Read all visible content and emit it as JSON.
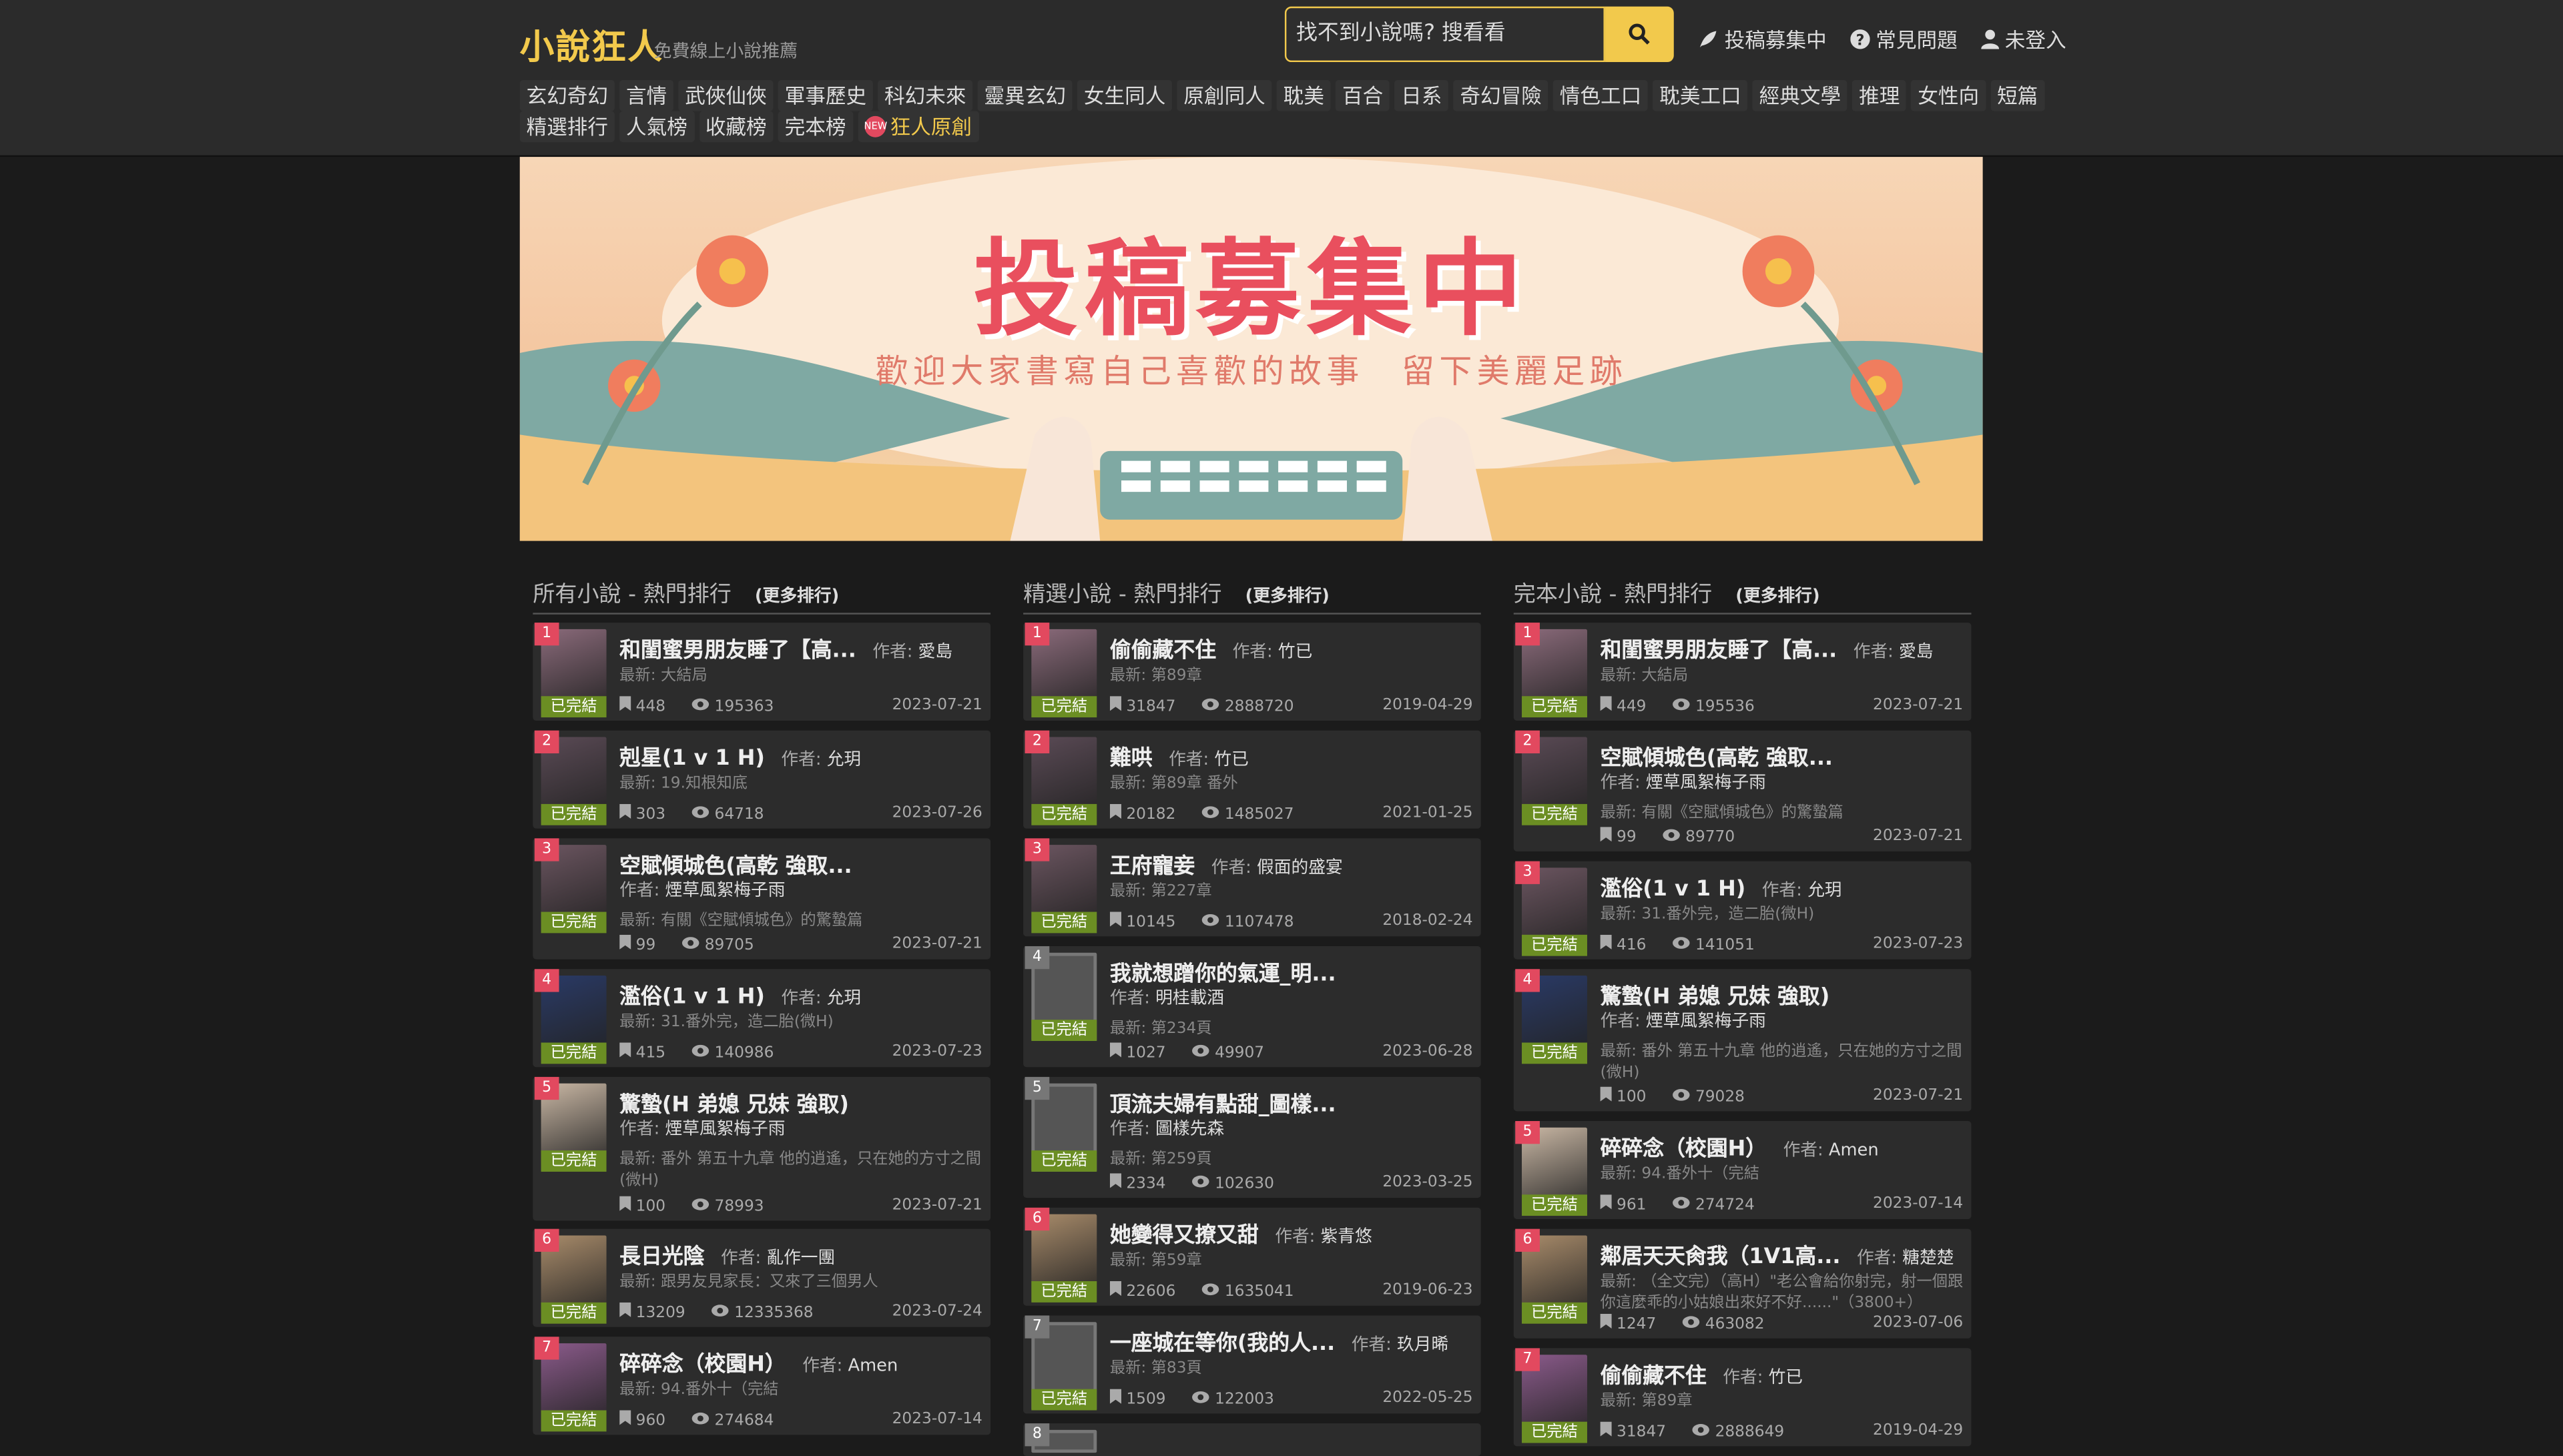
{
  "header": {
    "logo": "小說狂人",
    "tagline": "免費線上小說推薦",
    "search_value": "找不到小說嗎? 搜看看",
    "links": {
      "submit": "投稿募集中",
      "faq": "常見問題",
      "login": "未登入"
    },
    "nav_row1": [
      "玄幻奇幻",
      "言情",
      "武俠仙俠",
      "軍事歷史",
      "科幻未來",
      "靈異玄幻",
      "女生同人",
      "原創同人",
      "耽美",
      "百合",
      "日系",
      "奇幻冒險",
      "情色工口",
      "耽美工口",
      "經典文學",
      "推理",
      "女性向",
      "短篇"
    ],
    "nav_row2": [
      "精選排行",
      "人氣榜",
      "收藏榜",
      "完本榜"
    ],
    "nav_special": "狂人原創",
    "new_badge": "NEW"
  },
  "banner": {
    "title": "投稿募集中",
    "subtitle": "歡迎大家書寫自己喜歡的故事　留下美麗足跡"
  },
  "labels": {
    "author": "作者:",
    "latest": "最新:",
    "done": "已完結",
    "more": "(更多排行)"
  },
  "col1": {
    "title": "所有小說 - 熱門排行",
    "items": [
      {
        "rank": "1",
        "title": "和閨蜜男朋友睡了【高...",
        "author": "愛島",
        "latest": "大結局",
        "fav": "448",
        "views": "195363",
        "date": "2023-07-21"
      },
      {
        "rank": "2",
        "title": "剋星(1 v 1 H)",
        "author": "允玥",
        "latest": "19.知根知底",
        "fav": "303",
        "views": "64718",
        "date": "2023-07-26"
      },
      {
        "rank": "3",
        "title": "空賦傾城色(高乾 強取...",
        "author": "煙草風絮梅子雨",
        "latest": "有關《空賦傾城色》的驚蟄篇",
        "fav": "99",
        "views": "89705",
        "date": "2023-07-21"
      },
      {
        "rank": "4",
        "title": "濫俗(1 v 1 H)",
        "author": "允玥",
        "latest": "31.番外完，造二胎(微H)",
        "fav": "415",
        "views": "140986",
        "date": "2023-07-23"
      },
      {
        "rank": "5",
        "title": "驚蟄(H 弟媳 兄妹 強取)",
        "author": "煙草風絮梅子雨",
        "latest": "番外 第五十九章 他的逍遙，只在她的方寸之間",
        "latest2": "(微H)",
        "fav": "100",
        "views": "78993",
        "date": "2023-07-21"
      },
      {
        "rank": "6",
        "title": "長日光陰",
        "author": "亂作一團",
        "latest": "跟男友見家長：又來了三個男人",
        "fav": "13209",
        "views": "12335368",
        "date": "2023-07-24"
      },
      {
        "rank": "7",
        "title": "碎碎念（校園H）",
        "author": "Amen",
        "latest": "94.番外十（完結",
        "fav": "960",
        "views": "274684",
        "date": "2023-07-14"
      }
    ]
  },
  "col2": {
    "title": "精選小說 - 熱門排行",
    "items": [
      {
        "rank": "1",
        "title": "偷偷藏不住",
        "author": "竹已",
        "latest": "第89章",
        "fav": "31847",
        "views": "2888720",
        "date": "2019-04-29"
      },
      {
        "rank": "2",
        "title": "難哄",
        "author": "竹已",
        "latest": "第89章 番外",
        "fav": "20182",
        "views": "1485027",
        "date": "2021-01-25"
      },
      {
        "rank": "3",
        "title": "王府寵妾",
        "author": "假面的盛宴",
        "latest": "第227章",
        "fav": "10145",
        "views": "1107478",
        "date": "2018-02-24"
      },
      {
        "rank": "4",
        "title": "我就想蹭你的氣運_明...",
        "author": "明桂載酒",
        "latest": "第234頁",
        "fav": "1027",
        "views": "49907",
        "date": "2023-06-28"
      },
      {
        "rank": "5",
        "title": "頂流夫婦有點甜_圖樣...",
        "author": "圖樣先森",
        "latest": "第259頁",
        "fav": "2334",
        "views": "102630",
        "date": "2023-03-25"
      },
      {
        "rank": "6",
        "title": "她變得又撩又甜",
        "author": "紫青悠",
        "latest": "第59章",
        "fav": "22606",
        "views": "1635041",
        "date": "2019-06-23"
      },
      {
        "rank": "7",
        "title": "一座城在等你(我的人...",
        "author": "玖月晞",
        "latest": "第83頁",
        "fav": "1509",
        "views": "122003",
        "date": "2022-05-25"
      },
      {
        "rank": "8"
      }
    ]
  },
  "col3": {
    "title": "完本小說 - 熱門排行",
    "items": [
      {
        "rank": "1",
        "title": "和閨蜜男朋友睡了【高...",
        "author": "愛島",
        "latest": "大結局",
        "fav": "449",
        "views": "195536",
        "date": "2023-07-21"
      },
      {
        "rank": "2",
        "title": "空賦傾城色(高乾 強取...",
        "author": "煙草風絮梅子雨",
        "latest": "有關《空賦傾城色》的驚蟄篇",
        "fav": "99",
        "views": "89770",
        "date": "2023-07-21"
      },
      {
        "rank": "3",
        "title": "濫俗(1 v 1 H)",
        "author": "允玥",
        "latest": "31.番外完，造二胎(微H)",
        "fav": "416",
        "views": "141051",
        "date": "2023-07-23"
      },
      {
        "rank": "4",
        "title": "驚蟄(H 弟媳 兄妹 強取)",
        "author": "煙草風絮梅子雨",
        "latest": "番外 第五十九章 他的逍遙，只在她的方寸之間",
        "latest2": "(微H)",
        "fav": "100",
        "views": "79028",
        "date": "2023-07-21"
      },
      {
        "rank": "5",
        "title": "碎碎念（校園H）",
        "author": "Amen",
        "latest": "94.番外十（完結",
        "fav": "961",
        "views": "274724",
        "date": "2023-07-14"
      },
      {
        "rank": "6",
        "title": "鄰居天天肏我（1V1高...",
        "author": "糖楚楚",
        "latest": "（全文完）（高H）\"老公會給你射完，射一個跟",
        "latest2": "你這麼乖的小姑娘出來好不好......\"（3800+）",
        "fav": "1247",
        "views": "463082",
        "date": "2023-07-06"
      },
      {
        "rank": "7",
        "title": "偷偷藏不住",
        "author": "竹已",
        "latest": "第89章",
        "fav": "31847",
        "views": "2888649",
        "date": "2019-04-29"
      }
    ]
  }
}
